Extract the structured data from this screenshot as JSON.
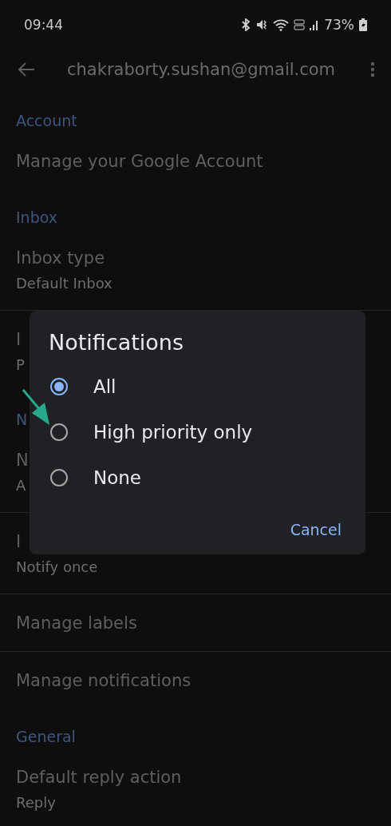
{
  "status_bar": {
    "time": "09:44",
    "battery": "73%"
  },
  "app_bar": {
    "title": "chakraborty.sushan@gmail.com"
  },
  "settings": [
    {
      "kind": "header",
      "title": "Account"
    },
    {
      "kind": "item",
      "title": "Manage your Google Account"
    },
    {
      "kind": "header",
      "title": "Inbox"
    },
    {
      "kind": "item",
      "title": "Inbox type",
      "subtitle": "Default Inbox"
    },
    {
      "kind": "divider"
    },
    {
      "kind": "item",
      "title": "I",
      "subtitle": "P"
    },
    {
      "kind": "header",
      "title": "N"
    },
    {
      "kind": "item",
      "title": "N",
      "subtitle": "A"
    },
    {
      "kind": "divider"
    },
    {
      "kind": "item",
      "title": "I",
      "subtitle": "Notify once"
    },
    {
      "kind": "divider"
    },
    {
      "kind": "item",
      "title": "Manage labels"
    },
    {
      "kind": "divider"
    },
    {
      "kind": "item",
      "title": "Manage notifications"
    },
    {
      "kind": "header",
      "title": "General"
    },
    {
      "kind": "item",
      "title": "Default reply action",
      "subtitle": "Reply"
    }
  ],
  "dialog": {
    "title": "Notifications",
    "options": [
      {
        "label": "All",
        "selected": true
      },
      {
        "label": "High priority only",
        "selected": false
      },
      {
        "label": "None",
        "selected": false
      }
    ],
    "buttons": [
      "Cancel"
    ]
  }
}
